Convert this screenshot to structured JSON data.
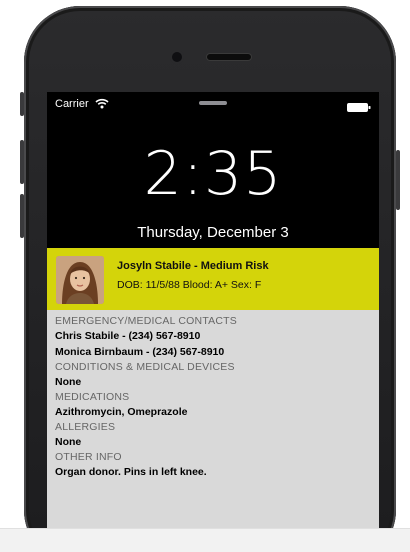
{
  "status_bar": {
    "carrier": "Carrier"
  },
  "lock_screen": {
    "time": "2:35",
    "date": "Thursday, December 3"
  },
  "medical_id": {
    "accent_color": "#d4d40a",
    "patient_name": "Josyln Stabile - Medium Risk",
    "patient_meta": "DOB: 11/5/88 Blood: A+ Sex: F",
    "sections": [
      {
        "label": "EMERGENCY/MEDICAL CONTACTS",
        "values": [
          "Chris Stabile - (234) 567-8910",
          "Monica Birnbaum - (234) 567-8910"
        ]
      },
      {
        "label": "CONDITIONS & MEDICAL DEVICES",
        "values": [
          "None"
        ]
      },
      {
        "label": "MEDICATIONS",
        "values": [
          "Azithromycin, Omeprazole"
        ]
      },
      {
        "label": "ALLERGIES",
        "values": [
          "None"
        ]
      },
      {
        "label": "OTHER INFO",
        "values": [
          "Organ donor. Pins in left knee."
        ]
      }
    ]
  },
  "icons": {
    "wifi": "wifi-icon",
    "battery": "battery-icon",
    "camera": "camera-icon",
    "avatar": "avatar"
  }
}
